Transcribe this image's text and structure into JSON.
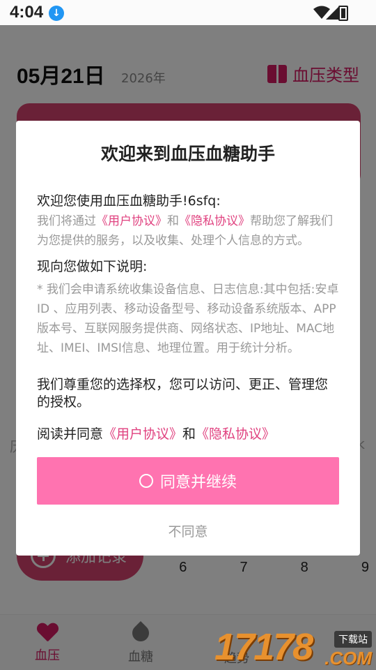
{
  "status": {
    "time": "4:04"
  },
  "header": {
    "date": "05月21日",
    "year": "2026年",
    "type_label": "血压类型"
  },
  "background": {
    "add_record": "添加记录",
    "days": [
      "6",
      "7",
      "8",
      "9"
    ],
    "left_char": "历",
    "right_char": "k"
  },
  "nav": {
    "bp": "血压",
    "bs": "血糖",
    "third": "趋势"
  },
  "watermark": {
    "num": "17178",
    "badge": "下载站",
    "com": ".COM"
  },
  "dialog": {
    "title": "欢迎来到血压血糖助手",
    "greeting": "欢迎您使用血压血糖助手!6sfq:",
    "intro_prefix": "我们将通过",
    "user_agreement": "《用户协议》",
    "and": "和",
    "privacy_agreement": "《隐私协议》",
    "intro_suffix": "帮助您了解我们为您提供的服务，以及收集、处理个人信息的方式。",
    "section_title": "现向您做如下说明:",
    "details": "* 我们会申请系统收集设备信息、日志信息:其中包括:安卓ID 、应用列表、移动设备型号、移动设备系统版本、APP版本号、互联网服务提供商、网络状态、IP地址、MAC地址、IMEI、IMSI信息、地理位置。用于统计分析。",
    "choice_text": "我们尊重您的选择权，您可以访问、更正、管理您的授权。",
    "read_agree": "阅读并同意",
    "agree_button": "同意并继续",
    "disagree_button": "不同意"
  }
}
